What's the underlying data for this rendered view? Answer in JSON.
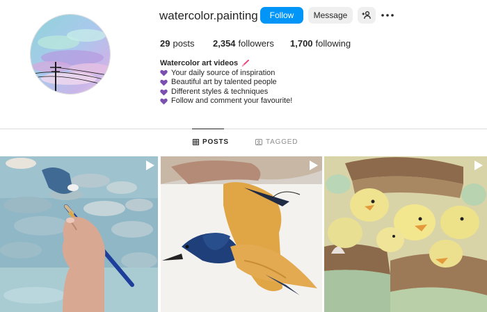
{
  "profile": {
    "username": "watercolor.painting",
    "follow_label": "Follow",
    "message_label": "Message",
    "add_user_icon": "add-user-icon",
    "more_icon": "more-icon"
  },
  "stats": {
    "posts_count": "29",
    "posts_label": "posts",
    "followers_count": "2,354",
    "followers_label": "followers",
    "following_count": "1,700",
    "following_label": "following"
  },
  "bio": {
    "title": "Watercolor art videos",
    "title_icon": "paintbrush-icon",
    "lines": [
      "Your daily source of inspiration",
      "Beautiful art by talented people",
      "Different styles & techniques",
      "Follow and comment your favourite!"
    ],
    "heart_color": "#7b4fb0"
  },
  "tabs": {
    "posts_label": "POSTS",
    "tagged_label": "TAGGED",
    "active": "POSTS"
  },
  "posts": [
    {
      "type": "reel",
      "subject": "hand painting blue watercolor stones"
    },
    {
      "type": "reel",
      "subject": "watercolor swallow bird painting"
    },
    {
      "type": "reel",
      "subject": "watercolor ducklings in baskets"
    }
  ],
  "colors": {
    "accent": "#0095f6",
    "button_bg": "#efefef",
    "divider": "#dbdbdb",
    "muted_text": "#8e8e8e"
  }
}
